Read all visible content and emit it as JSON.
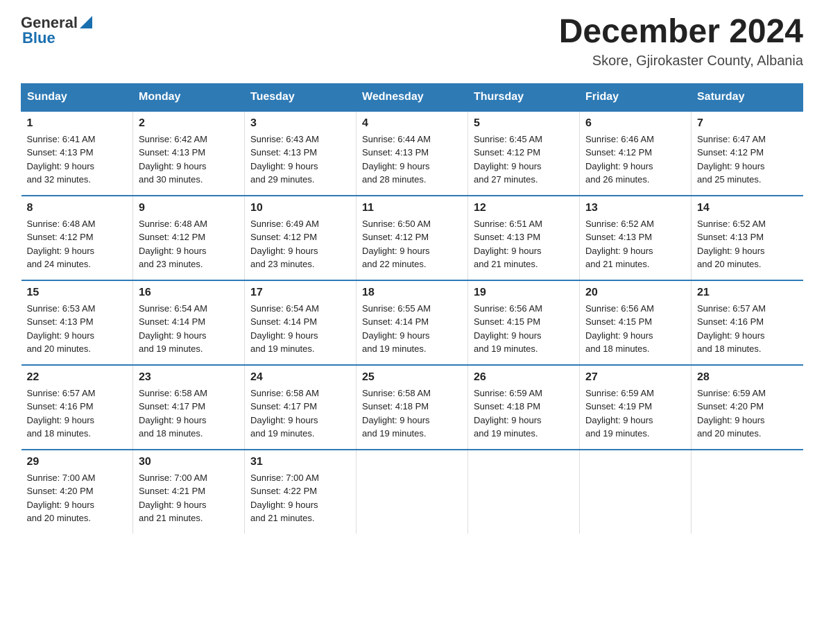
{
  "header": {
    "logo": {
      "general": "General",
      "blue": "Blue"
    },
    "title": "December 2024",
    "location": "Skore, Gjirokaster County, Albania"
  },
  "calendar": {
    "weekdays": [
      "Sunday",
      "Monday",
      "Tuesday",
      "Wednesday",
      "Thursday",
      "Friday",
      "Saturday"
    ],
    "weeks": [
      [
        {
          "day": "1",
          "sunrise": "6:41 AM",
          "sunset": "4:13 PM",
          "daylight": "9 hours and 32 minutes."
        },
        {
          "day": "2",
          "sunrise": "6:42 AM",
          "sunset": "4:13 PM",
          "daylight": "9 hours and 30 minutes."
        },
        {
          "day": "3",
          "sunrise": "6:43 AM",
          "sunset": "4:13 PM",
          "daylight": "9 hours and 29 minutes."
        },
        {
          "day": "4",
          "sunrise": "6:44 AM",
          "sunset": "4:13 PM",
          "daylight": "9 hours and 28 minutes."
        },
        {
          "day": "5",
          "sunrise": "6:45 AM",
          "sunset": "4:12 PM",
          "daylight": "9 hours and 27 minutes."
        },
        {
          "day": "6",
          "sunrise": "6:46 AM",
          "sunset": "4:12 PM",
          "daylight": "9 hours and 26 minutes."
        },
        {
          "day": "7",
          "sunrise": "6:47 AM",
          "sunset": "4:12 PM",
          "daylight": "9 hours and 25 minutes."
        }
      ],
      [
        {
          "day": "8",
          "sunrise": "6:48 AM",
          "sunset": "4:12 PM",
          "daylight": "9 hours and 24 minutes."
        },
        {
          "day": "9",
          "sunrise": "6:48 AM",
          "sunset": "4:12 PM",
          "daylight": "9 hours and 23 minutes."
        },
        {
          "day": "10",
          "sunrise": "6:49 AM",
          "sunset": "4:12 PM",
          "daylight": "9 hours and 23 minutes."
        },
        {
          "day": "11",
          "sunrise": "6:50 AM",
          "sunset": "4:12 PM",
          "daylight": "9 hours and 22 minutes."
        },
        {
          "day": "12",
          "sunrise": "6:51 AM",
          "sunset": "4:13 PM",
          "daylight": "9 hours and 21 minutes."
        },
        {
          "day": "13",
          "sunrise": "6:52 AM",
          "sunset": "4:13 PM",
          "daylight": "9 hours and 21 minutes."
        },
        {
          "day": "14",
          "sunrise": "6:52 AM",
          "sunset": "4:13 PM",
          "daylight": "9 hours and 20 minutes."
        }
      ],
      [
        {
          "day": "15",
          "sunrise": "6:53 AM",
          "sunset": "4:13 PM",
          "daylight": "9 hours and 20 minutes."
        },
        {
          "day": "16",
          "sunrise": "6:54 AM",
          "sunset": "4:14 PM",
          "daylight": "9 hours and 19 minutes."
        },
        {
          "day": "17",
          "sunrise": "6:54 AM",
          "sunset": "4:14 PM",
          "daylight": "9 hours and 19 minutes."
        },
        {
          "day": "18",
          "sunrise": "6:55 AM",
          "sunset": "4:14 PM",
          "daylight": "9 hours and 19 minutes."
        },
        {
          "day": "19",
          "sunrise": "6:56 AM",
          "sunset": "4:15 PM",
          "daylight": "9 hours and 19 minutes."
        },
        {
          "day": "20",
          "sunrise": "6:56 AM",
          "sunset": "4:15 PM",
          "daylight": "9 hours and 18 minutes."
        },
        {
          "day": "21",
          "sunrise": "6:57 AM",
          "sunset": "4:16 PM",
          "daylight": "9 hours and 18 minutes."
        }
      ],
      [
        {
          "day": "22",
          "sunrise": "6:57 AM",
          "sunset": "4:16 PM",
          "daylight": "9 hours and 18 minutes."
        },
        {
          "day": "23",
          "sunrise": "6:58 AM",
          "sunset": "4:17 PM",
          "daylight": "9 hours and 18 minutes."
        },
        {
          "day": "24",
          "sunrise": "6:58 AM",
          "sunset": "4:17 PM",
          "daylight": "9 hours and 19 minutes."
        },
        {
          "day": "25",
          "sunrise": "6:58 AM",
          "sunset": "4:18 PM",
          "daylight": "9 hours and 19 minutes."
        },
        {
          "day": "26",
          "sunrise": "6:59 AM",
          "sunset": "4:18 PM",
          "daylight": "9 hours and 19 minutes."
        },
        {
          "day": "27",
          "sunrise": "6:59 AM",
          "sunset": "4:19 PM",
          "daylight": "9 hours and 19 minutes."
        },
        {
          "day": "28",
          "sunrise": "6:59 AM",
          "sunset": "4:20 PM",
          "daylight": "9 hours and 20 minutes."
        }
      ],
      [
        {
          "day": "29",
          "sunrise": "7:00 AM",
          "sunset": "4:20 PM",
          "daylight": "9 hours and 20 minutes."
        },
        {
          "day": "30",
          "sunrise": "7:00 AM",
          "sunset": "4:21 PM",
          "daylight": "9 hours and 21 minutes."
        },
        {
          "day": "31",
          "sunrise": "7:00 AM",
          "sunset": "4:22 PM",
          "daylight": "9 hours and 21 minutes."
        },
        null,
        null,
        null,
        null
      ]
    ]
  }
}
